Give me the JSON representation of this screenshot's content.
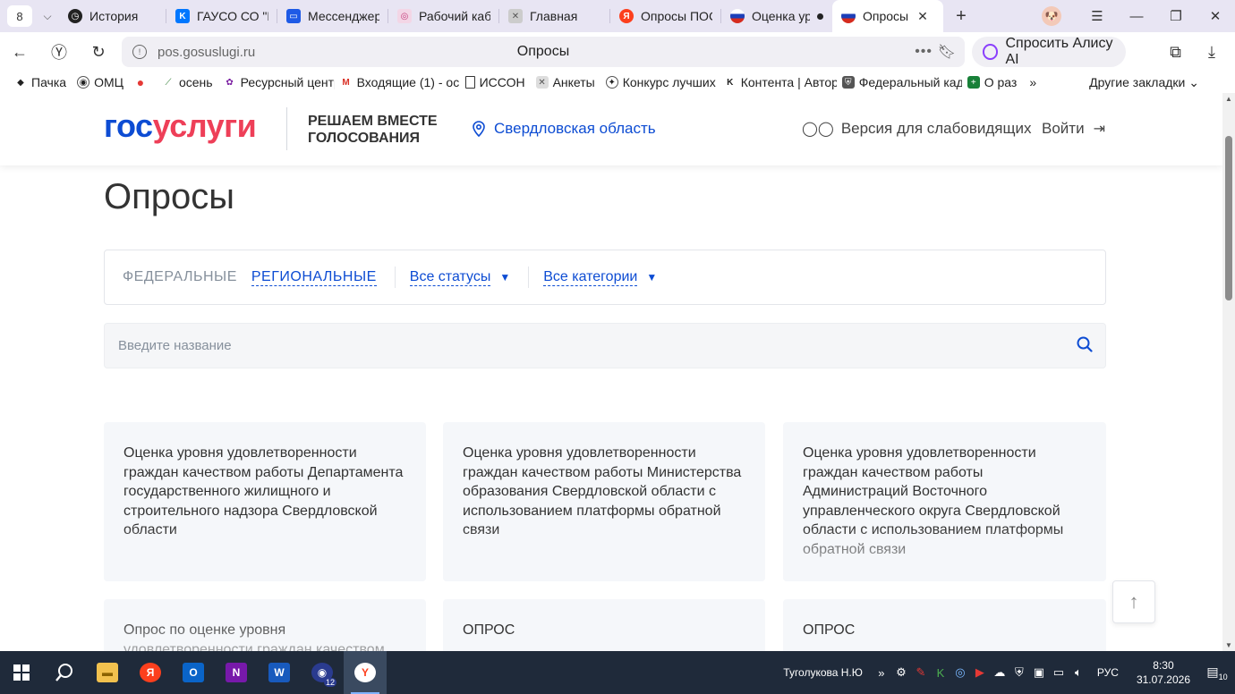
{
  "browser": {
    "tab_count": "8",
    "tabs": [
      {
        "label": "История",
        "icon": "clock-icon",
        "color": "#222222"
      },
      {
        "label": "ГАУСО СО \"К",
        "icon": "vk-icon",
        "color": "#0077ff"
      },
      {
        "label": "Мессенджер",
        "icon": "messenger-icon",
        "color": "#1e5ae6"
      },
      {
        "label": "Рабочий каб",
        "icon": "cabinet-icon",
        "color": "#c43b7a"
      },
      {
        "label": "Главная",
        "icon": "main-icon",
        "color": "#7a7a7a"
      },
      {
        "label": "Опросы ПОС",
        "icon": "yandex-icon",
        "color": "#fc3f1d"
      },
      {
        "label": "Оценка ур",
        "icon": "flag-icon",
        "color": "#d52b1e"
      },
      {
        "label": "Опросы",
        "icon": "flag-icon",
        "color": "#d52b1e"
      }
    ],
    "url": "pos.gosuslugi.ru",
    "page_title": "Опросы",
    "alice_label": "Спросить Алису AI",
    "bookmarks": [
      {
        "label": "Пачка",
        "icon": "pachka-icon"
      },
      {
        "label": "ОМЦ",
        "icon": "omc-icon"
      },
      {
        "label": "",
        "icon": "map-pin-icon"
      },
      {
        "label": "осень",
        "icon": "leaf-icon"
      },
      {
        "label": "Ресурсный центр",
        "icon": "resource-icon"
      },
      {
        "label": "Входящие (1) - ос",
        "icon": "gmail-icon"
      },
      {
        "label": "ИССОН",
        "icon": "page-icon"
      },
      {
        "label": "Анкеты",
        "icon": "forms-icon"
      },
      {
        "label": "Конкурс лучших п",
        "icon": "contest-icon"
      },
      {
        "label": "Контента | Автор",
        "icon": "k-icon"
      },
      {
        "label": "Федеральный кад",
        "icon": "shield-icon"
      },
      {
        "label": "О раз",
        "icon": "sheets-icon"
      }
    ],
    "other_bookmarks": "Другие закладки"
  },
  "site": {
    "logo_part1": "гос",
    "logo_part2": "услуги",
    "slogan": "РЕШАЕМ ВМЕСТЕ ГОЛОСОВАНИЯ",
    "region": "Свердловская область",
    "low_vision": "Версия для слабовидящих",
    "login": "Войти"
  },
  "page": {
    "title": "Опросы",
    "filter_tabs": [
      "ФЕДЕРАЛЬНЫЕ",
      "РЕГИОНАЛЬНЫЕ"
    ],
    "active_filter": "РЕГИОНАЛЬНЫЕ",
    "status_dropdown": "Все статусы",
    "category_dropdown": "Все категории",
    "search_placeholder": "Введите название",
    "cards": [
      "Оценка уровня удовлетворенности граждан качеством работы Департамента государственного жилищного и строительного надзора Свердловской области",
      "Оценка уровня удовлетворенности граждан качеством работы Министерства образования Свердловской области с использованием платформы обратной связи",
      "Оценка уровня удовлетворенности граждан качеством работы Администраций Восточного управленческого округа Свердловской области с использованием платформы обратной связи",
      "Опрос по оценке уровня удовлетворенности граждан качеством",
      "ОПРОС",
      "ОПРОС"
    ]
  },
  "taskbar": {
    "user": "Туголукова Н.Ю",
    "lang": "РУС",
    "time": "8:30",
    "date": "31.07.2026",
    "notifications": "10",
    "app_badge": "12"
  }
}
